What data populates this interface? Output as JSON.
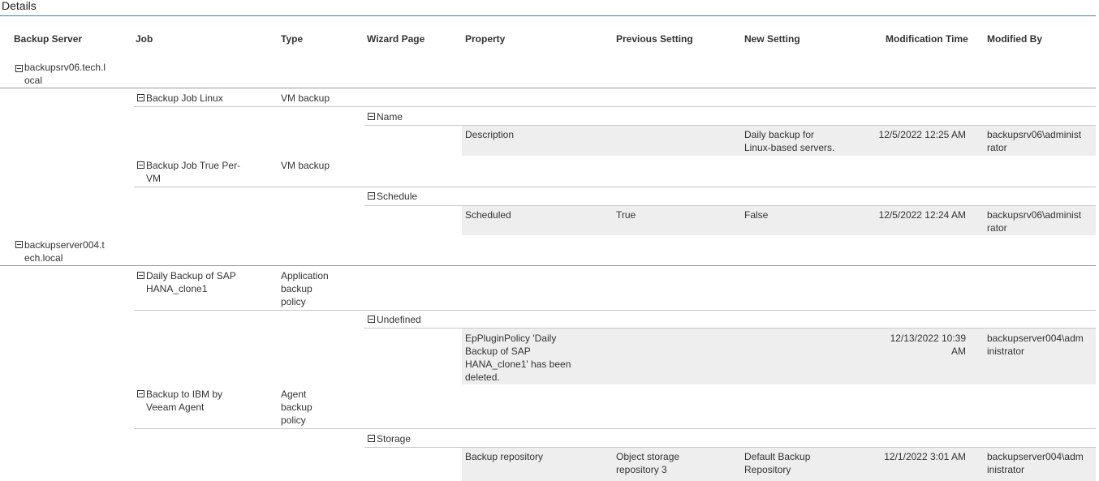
{
  "title": "Details",
  "headers": {
    "server": "Backup Server",
    "job": "Job",
    "type": "Type",
    "wizard": "Wizard Page",
    "property": "Property",
    "prev": "Previous Setting",
    "new": "New Setting",
    "time": "Modification Time",
    "by": "Modified By"
  },
  "servers": [
    {
      "name": "backupsrv06.tech.l\nocal",
      "jobs": [
        {
          "name": "Backup Job Linux",
          "type": "VM backup",
          "page": "Name",
          "property": "Description",
          "prev": "",
          "new": "Daily backup for\nLinux-based servers.",
          "time": "12/5/2022 12:25 AM",
          "by": "backupsrv06\\administ\nrator"
        },
        {
          "name": "Backup Job True Per-\nVM",
          "type": "VM backup",
          "page": "Schedule",
          "property": "Scheduled",
          "prev": "True",
          "new": "False",
          "time": "12/5/2022 12:24 AM",
          "by": "backupsrv06\\administ\nrator"
        }
      ]
    },
    {
      "name": "backupserver004.t\nech.local",
      "jobs": [
        {
          "name": "Daily Backup of SAP\nHANA_clone1",
          "type": "Application\nbackup\npolicy",
          "page": "Undefined",
          "property": "EpPluginPolicy 'Daily\nBackup of SAP\nHANA_clone1' has been\ndeleted.",
          "prev": "",
          "new": "",
          "time": "12/13/2022 10:39\nAM",
          "by": "backupserver004\\adm\ninistrator"
        },
        {
          "name": "Backup to IBM by\nVeeam Agent",
          "type": "Agent\nbackup\npolicy",
          "page": "Storage",
          "property": "Backup repository",
          "prev": "Object storage\nrepository 3",
          "new": "Default Backup\nRepository",
          "time": "12/1/2022 3:01 AM",
          "by": "backupserver004\\adm\ninistrator"
        }
      ]
    }
  ]
}
